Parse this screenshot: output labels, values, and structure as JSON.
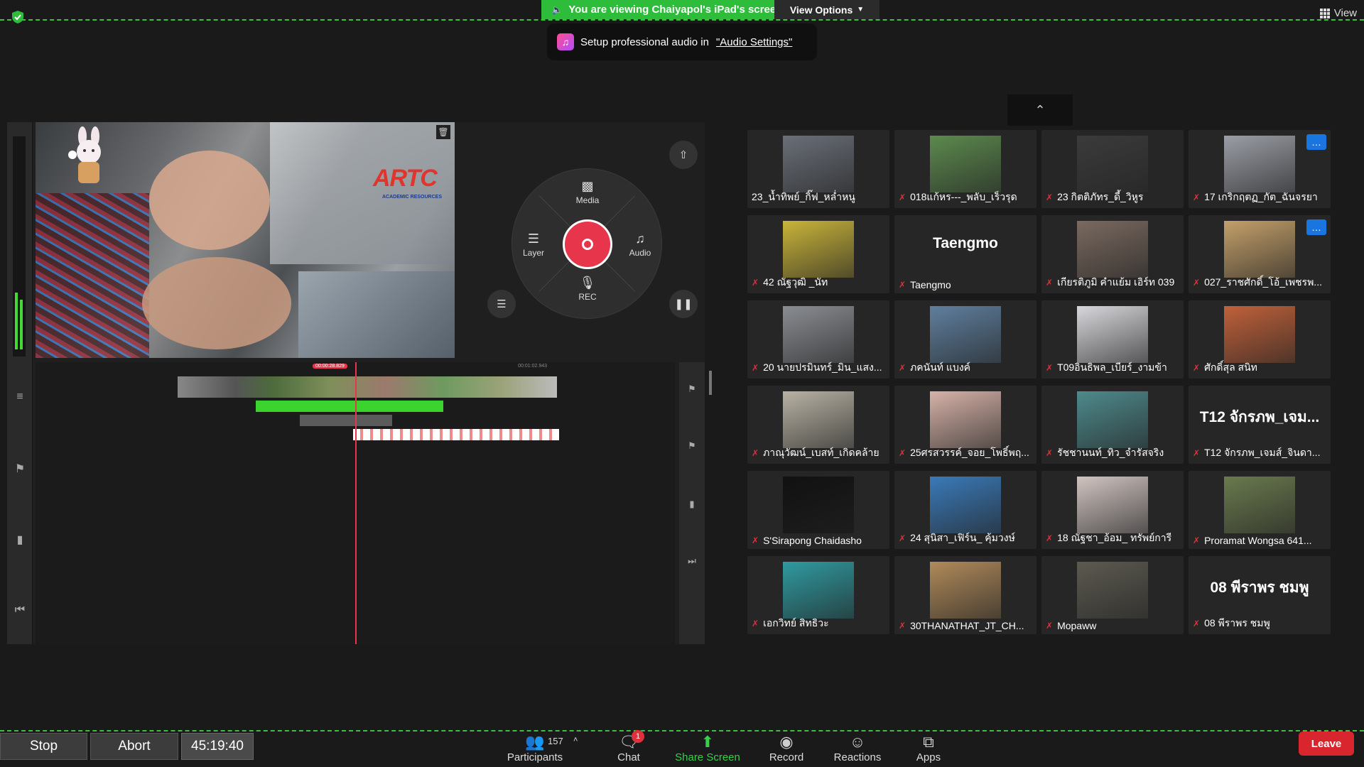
{
  "banner": {
    "viewing_text": "You are viewing Chaiyapol's iPad's screen",
    "view_options_label": "View Options"
  },
  "top_right": {
    "view_label": "View"
  },
  "audio_tip": {
    "prefix": "Setup professional audio in",
    "link": "\"Audio Settings\""
  },
  "editor": {
    "wheel": {
      "media": "Media",
      "layer": "Layer",
      "audio": "Audio",
      "rec": "REC"
    },
    "timecode_current": "00:00:28.829",
    "timecode_total": "00:01:02.943",
    "logo_text": "ARTC",
    "logo_sub": "ACADEMIC RESOURCES"
  },
  "participants": [
    {
      "name": "23_น้ำทิพย์_กิ๊ฟ_หล่ำหนู",
      "muted": false,
      "kind": "photo",
      "color": "#6a6f78"
    },
    {
      "name": "018แก้หร---_พลับ_เร็วรุด",
      "muted": true,
      "kind": "photo",
      "color": "#5c8a4e"
    },
    {
      "name": "23 กิตติภัทร_ดี้_วิหูร",
      "muted": true,
      "kind": "photo",
      "color": "#3b3b3b"
    },
    {
      "name": "17 เกริกฤตฏ_กัต_ฉันจรยา",
      "muted": true,
      "kind": "photo",
      "color": "#9b9ea6",
      "more": true
    },
    {
      "name": "42 ณัฐวุฒิ _นัท",
      "muted": true,
      "kind": "photo",
      "color": "#c9b43a"
    },
    {
      "name": "Taengmo",
      "muted": true,
      "kind": "text",
      "big": "Taengmo"
    },
    {
      "name": "เกียรติภูมิ คำแย้ม เอิร์ท 039",
      "muted": true,
      "kind": "photo",
      "color": "#7a6a60"
    },
    {
      "name": "027_ราชศักดิ์_โอ้_เพชรพ...",
      "muted": true,
      "kind": "photo",
      "color": "#c4a06a",
      "more": true
    },
    {
      "name": "20 นายปรมินทร์_มิน_แสง...",
      "muted": true,
      "kind": "photo",
      "color": "#8a8d92"
    },
    {
      "name": "ภคนันท์ แบงค์",
      "muted": true,
      "kind": "photo",
      "color": "#5f7f9e"
    },
    {
      "name": "T09อินธิพล_เบียร์_งามข้า",
      "muted": true,
      "kind": "photo",
      "color": "#d8d8dc"
    },
    {
      "name": "ศักดิ์สุล สนิท",
      "muted": true,
      "kind": "photo",
      "color": "#c0613a"
    },
    {
      "name": "ภาณุวัฒน์_เบสท์_เกิดคล้าย",
      "muted": true,
      "kind": "photo",
      "color": "#b8b2a4"
    },
    {
      "name": "25ศรสวรรค์_จอย_โพธิ์พฤ...",
      "muted": true,
      "kind": "photo",
      "color": "#d6b2a8"
    },
    {
      "name": "รัชชานนท์_ทิว_จำรัสจริง",
      "muted": true,
      "kind": "photo",
      "color": "#4e8a8c"
    },
    {
      "name": "T12 จักรภพ_เจมส์_จินดา...",
      "muted": true,
      "kind": "text",
      "big": "T12 จักรภพ_เจม..."
    },
    {
      "name": "S'Sirapong Chaidasho",
      "muted": true,
      "kind": "photo",
      "color": "#111111"
    },
    {
      "name": "24 สุนิสา_เฟิร์น_ คุ้มวงษ์",
      "muted": true,
      "kind": "photo",
      "color": "#3a7ab8"
    },
    {
      "name": "18 ณัฐชา_อ้อม_ ทรัพย์การี",
      "muted": true,
      "kind": "photo",
      "color": "#d0c4c0"
    },
    {
      "name": "Proramat Wongsa 641...",
      "muted": true,
      "kind": "photo",
      "color": "#6a7a4e"
    },
    {
      "name": "เอกวิทย์ สิทธิวะ",
      "muted": true,
      "kind": "photo",
      "color": "#2f9aa0"
    },
    {
      "name": "30THANATHAT_JT_CH...",
      "muted": true,
      "kind": "photo",
      "color": "#b08a5a"
    },
    {
      "name": "Mopaww",
      "muted": true,
      "kind": "photo",
      "color": "#5c5a50"
    },
    {
      "name": "08 พีราพร ชมพู",
      "muted": true,
      "kind": "text",
      "big": "08 พีราพร ชมพู"
    }
  ],
  "toolbar": {
    "participants_label": "Participants",
    "participants_count": "157",
    "chat_label": "Chat",
    "chat_badge": "1",
    "share_label": "Share Screen",
    "record_label": "Record",
    "reactions_label": "Reactions",
    "apps_label": "Apps",
    "leave_label": "Leave"
  },
  "recorder": {
    "stop_label": "Stop",
    "abort_label": "Abort",
    "elapsed": "45:19:40"
  },
  "colors": {
    "share_green": "#2dbd3a",
    "dash_green": "#3fbf3f",
    "rec_red": "#e7364c",
    "leave_red": "#d9262e",
    "more_blue": "#1976e0"
  }
}
